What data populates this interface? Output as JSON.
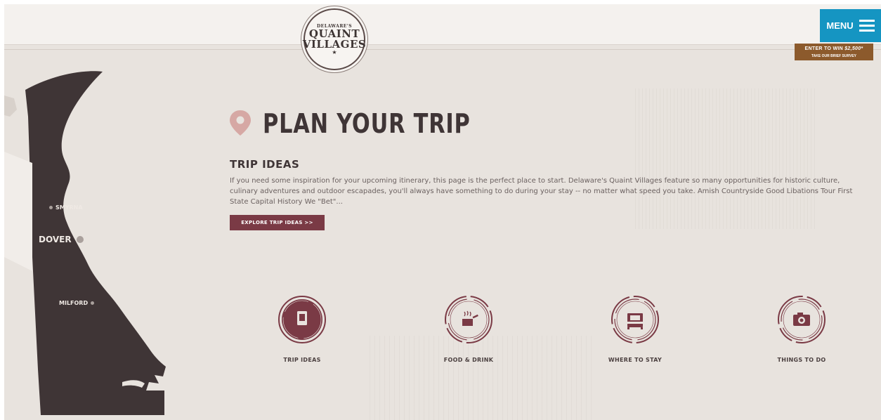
{
  "logo": {
    "top_text": "DELAWARE'S",
    "line1": "QUAINT",
    "line2": "VILLAGES",
    "star": "★"
  },
  "header": {
    "menu_label": "MENU",
    "survey_line1_prefix": "ENTER TO WIN ",
    "survey_line1_amount": "$2,500*",
    "survey_line2": "TAKE OUR BRIEF SURVEY"
  },
  "map": {
    "towns": [
      {
        "name": "SMYRNA"
      },
      {
        "name": "DOVER"
      },
      {
        "name": "MILFORD"
      }
    ],
    "fill_color": "#3f3536"
  },
  "main": {
    "title": "PLAN YOUR TRIP",
    "section_heading": "TRIP IDEAS",
    "section_body": "If you need some inspiration for your upcoming itinerary, this page is the perfect place to start. Delaware's Quaint Villages feature so many opportunities for historic culture, culinary adventures and outdoor escapades, you'll always have something to do during your stay -- no matter what speed you take. Amish Countryside Good Libations Tour First State Capital History We \"Bet\"...",
    "explore_button": "EXPLORE TRIP IDEAS >>"
  },
  "categories": [
    {
      "label": "TRIP IDEAS",
      "icon": "trip-ideas-icon",
      "active": true
    },
    {
      "label": "FOOD & DRINK",
      "icon": "food-drink-icon",
      "active": false
    },
    {
      "label": "WHERE TO STAY",
      "icon": "bed-icon",
      "active": false
    },
    {
      "label": "THINGS TO DO",
      "icon": "camera-icon",
      "active": false
    }
  ],
  "colors": {
    "accent": "#7a3a45",
    "menu_blue": "#1595c2",
    "survey_brown": "#8c5a2c",
    "text_dark": "#3f3536",
    "background": "#e8e3de"
  }
}
